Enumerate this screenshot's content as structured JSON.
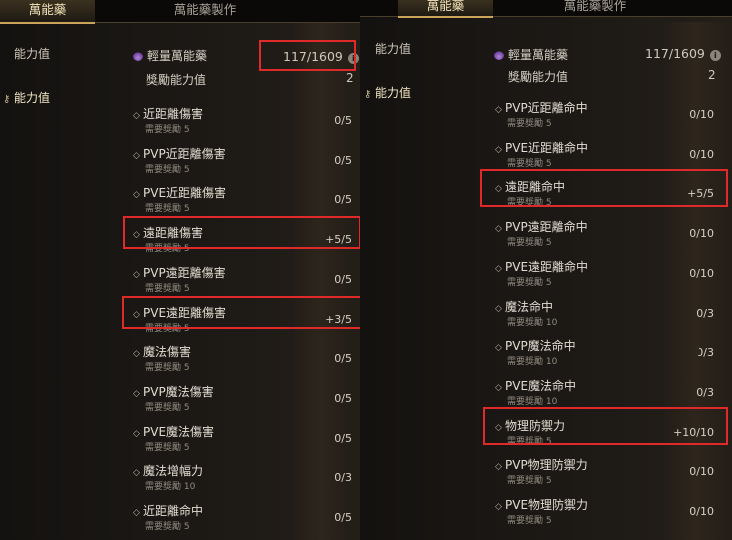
{
  "left": {
    "tabs": [
      {
        "label": "萬能藥"
      },
      {
        "label": "萬能藥製作"
      }
    ],
    "sidebar": [
      {
        "icon": "stat-icon",
        "label": "能力值"
      },
      {
        "icon": "stat-icon",
        "label": "能力值"
      }
    ],
    "header": {
      "item_name": "輕量萬能藥",
      "count": "117/1609",
      "info": "i",
      "reward_label": "獎勵能力值",
      "reward_value": "2"
    },
    "items": [
      {
        "name": "近距離傷害",
        "req": "需要獎勵 5",
        "count": "0/5"
      },
      {
        "name": "PVP近距離傷害",
        "req": "需要獎勵 5",
        "count": "0/5"
      },
      {
        "name": "PVE近距離傷害",
        "req": "需要獎勵 5",
        "count": "0/5"
      },
      {
        "name": "遠距離傷害",
        "req": "需要獎勵 5",
        "count": "+5/5"
      },
      {
        "name": "PVP遠距離傷害",
        "req": "需要獎勵 5",
        "count": "0/5"
      },
      {
        "name": "PVE遠距離傷害",
        "req": "需要獎勵 5",
        "count": "+3/5"
      },
      {
        "name": "魔法傷害",
        "req": "需要獎勵 5",
        "count": "0/5"
      },
      {
        "name": "PVP魔法傷害",
        "req": "需要獎勵 5",
        "count": "0/5"
      },
      {
        "name": "PVE魔法傷害",
        "req": "需要獎勵 5",
        "count": "0/5"
      },
      {
        "name": "魔法增幅力",
        "req": "需要獎勵 10",
        "count": "0/3"
      },
      {
        "name": "近距離命中",
        "req": "需要獎勵 5",
        "count": "0/5"
      }
    ]
  },
  "right": {
    "tabs": [
      {
        "label": "萬能藥"
      },
      {
        "label": "萬能藥製作"
      }
    ],
    "sidebar": [
      {
        "icon": "stat-icon",
        "label": "能力值"
      },
      {
        "icon": "stat-icon",
        "label": "能力值"
      }
    ],
    "header": {
      "item_name": "輕量萬能藥",
      "count": "117/1609",
      "info": "i",
      "reward_label": "獎勵能力值",
      "reward_value": "2"
    },
    "items": [
      {
        "name": "PVP近距離命中",
        "req": "需要獎勵 5",
        "count": "0/10"
      },
      {
        "name": "PVE近距離命中",
        "req": "需要獎勵 5",
        "count": "0/10"
      },
      {
        "name": "遠距離命中",
        "req": "需要獎勵 5",
        "count": "+5/5"
      },
      {
        "name": "PVP遠距離命中",
        "req": "需要獎勵 5",
        "count": "0/10"
      },
      {
        "name": "PVE遠距離命中",
        "req": "需要獎勵 5",
        "count": "0/10"
      },
      {
        "name": "魔法命中",
        "req": "需要獎勵 10",
        "count": "0/3"
      },
      {
        "name": "PVP魔法命中",
        "req": "需要獎勵 10",
        "count": "0/3"
      },
      {
        "name": "PVE魔法命中",
        "req": "需要獎勵 10",
        "count": "0/3"
      },
      {
        "name": "物理防禦力",
        "req": "需要獎勵 5",
        "count": "+10/10"
      },
      {
        "name": "PVP物理防禦力",
        "req": "需要獎勵 5",
        "count": "0/10"
      },
      {
        "name": "PVE物理防禦力",
        "req": "需要獎勵 5",
        "count": "0/10"
      }
    ]
  },
  "colors": {
    "highlight": "#e02a2a",
    "accent": "#c9a45a"
  }
}
